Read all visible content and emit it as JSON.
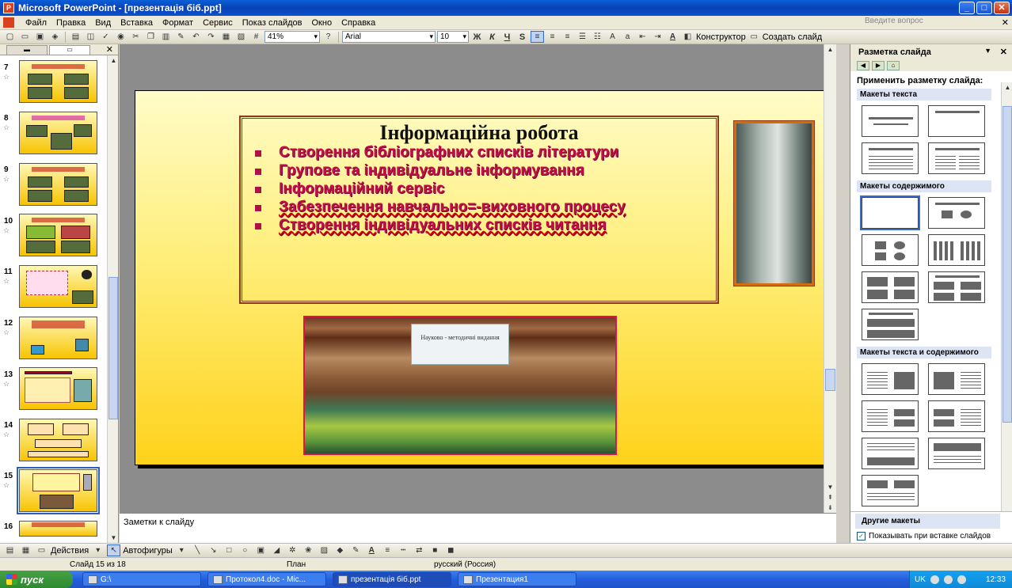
{
  "window": {
    "title": "Microsoft PowerPoint - [презентація біб.ppt]"
  },
  "menu": {
    "items": [
      "Файл",
      "Правка",
      "Вид",
      "Вставка",
      "Формат",
      "Сервис",
      "Показ слайдов",
      "Окно",
      "Справка"
    ],
    "help_placeholder": "Введите вопрос"
  },
  "toolbar": {
    "zoom": "41%",
    "font": "Arial",
    "font_size": "10",
    "bold": "Ж",
    "italic": "К",
    "underline": "Ч",
    "shadow": "S",
    "designer": "Конструктор",
    "new_slide": "Создать слайд"
  },
  "thumbnails": {
    "numbers": [
      "7",
      "8",
      "9",
      "10",
      "11",
      "12",
      "13",
      "14",
      "15",
      "16"
    ],
    "selected": "15"
  },
  "slide": {
    "title": "Інформаційна робота",
    "bullets": [
      "Створення бібліографних списків літератури",
      "Групове та  індивідуальне інформування",
      "Інформаційний сервіс",
      "Забезпечення навчально=-виховного процесу",
      "Створення індивідуальних списків читання"
    ],
    "photo_card_text": "Науково - методичні видання"
  },
  "notes": {
    "placeholder": "Заметки к слайду"
  },
  "task_pane": {
    "title": "Разметка слайда",
    "apply_label": "Применить разметку слайда:",
    "sections": [
      "Макеты текста",
      "Макеты содержимого",
      "Макеты текста и содержимого"
    ],
    "more": "Другие макеты",
    "show_on_insert": "Показывать при вставке слайдов"
  },
  "drawing": {
    "actions": "Действия",
    "autoshapes": "Автофигуры"
  },
  "status": {
    "slide": "Слайд 15 из 18",
    "design": "План",
    "language": "русский (Россия)"
  },
  "taskbar": {
    "start": "пуск",
    "tasks": [
      "G:\\",
      "Протокол4.doc - Mic...",
      "презентація біб.ppt",
      "Презентация1"
    ],
    "lang": "UK",
    "clock": "12:33"
  },
  "colors": {
    "accent": "#c0104a",
    "slide_top": "#fffcc8",
    "slide_bottom": "#ffd21a",
    "titlebar": "#0841b5"
  }
}
